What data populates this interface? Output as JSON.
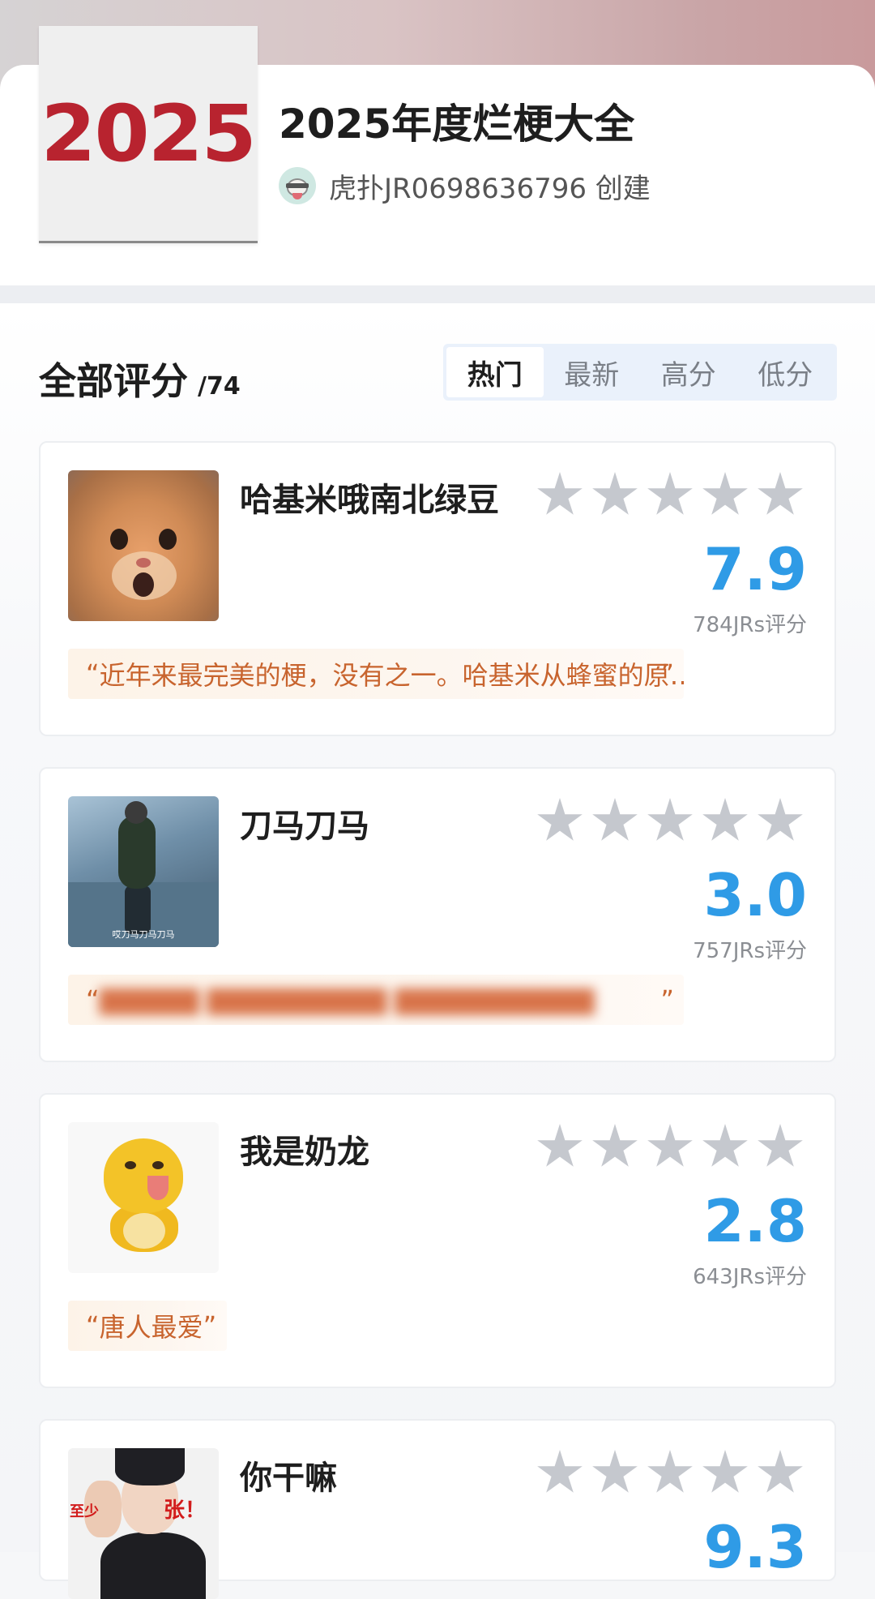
{
  "header": {
    "cover_text": "2025",
    "title": "2025年度烂梗大全",
    "creator": "虎扑JR0698636796 创建"
  },
  "ratings": {
    "title": "全部评分",
    "count": "/74",
    "tabs": [
      {
        "label": "热门",
        "active": true
      },
      {
        "label": "最新",
        "active": false
      },
      {
        "label": "高分",
        "active": false
      },
      {
        "label": "低分",
        "active": false
      }
    ],
    "items": [
      {
        "title": "哈基米哦南北绿豆",
        "score": "7.9",
        "raters": "784JRs评分",
        "quote": "近年来最完美的梗，没有之一。哈基米从蜂蜜的原…",
        "quote_open": "“",
        "quote_close": "”",
        "thumb_icon": "surprised-cat-icon"
      },
      {
        "title": "刀马刀马",
        "score": "3.0",
        "raters": "757JRs评分",
        "quote_open": "“",
        "quote_close": "”",
        "thumb_caption": "哎刀马刀马刀马",
        "thumb_icon": "dancing-figure-icon"
      },
      {
        "title": "我是奶龙",
        "score": "2.8",
        "raters": "643JRs评分",
        "quote": "唐人最爱",
        "quote_open": "“",
        "quote_close": "”",
        "thumb_icon": "yellow-duck-icon"
      },
      {
        "title": "你干嘛",
        "score": "9.3",
        "thumb_text_1": "至少",
        "thumb_text_2": "张！",
        "thumb_icon": "idol-boy-icon"
      }
    ]
  },
  "colors": {
    "accent_blue": "#2f9be6",
    "quote_text": "#c8642e",
    "cover_red": "#b8232f",
    "star_gray": "#c5c8ce"
  }
}
